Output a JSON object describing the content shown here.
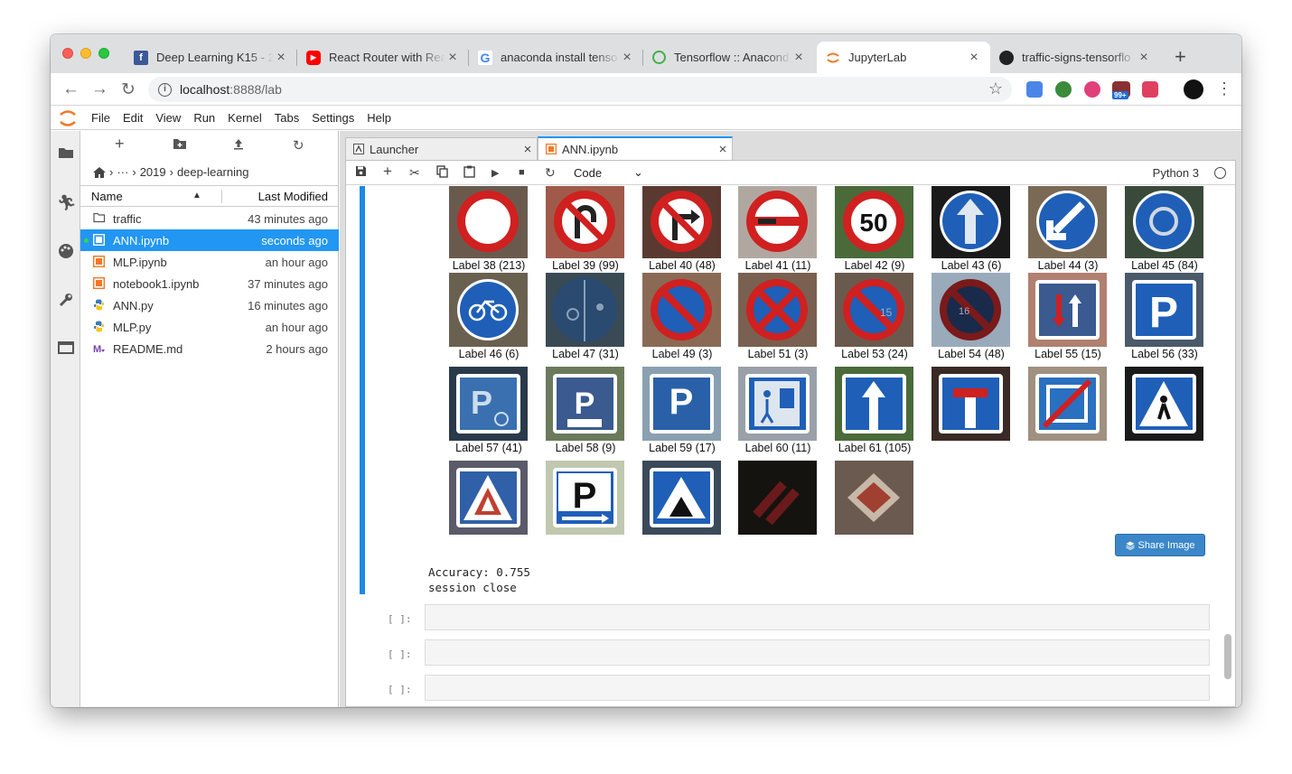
{
  "browser": {
    "tabs": [
      {
        "title": "Deep Learning K15 - 2",
        "icon": "facebook-icon",
        "color": "#3b5998",
        "active": false
      },
      {
        "title": "React Router with Rea",
        "icon": "youtube-icon",
        "color": "#ff0000",
        "active": false
      },
      {
        "title": "anaconda install tenso",
        "icon": "google-icon",
        "color": "#4285f4",
        "active": false
      },
      {
        "title": "Tensorflow :: Anacond",
        "icon": "anaconda-icon",
        "color": "#43b049",
        "active": false
      },
      {
        "title": "JupyterLab",
        "icon": "jupyter-icon",
        "color": "#f37726",
        "active": true
      },
      {
        "title": "traffic-signs-tensorflo",
        "icon": "github-icon",
        "color": "#222222",
        "active": false
      }
    ],
    "url_host": "localhost",
    "url_rest": ":8888/lab",
    "extension_badge": "99+"
  },
  "jupyter": {
    "menu": [
      "File",
      "Edit",
      "View",
      "Run",
      "Kernel",
      "Tabs",
      "Settings",
      "Help"
    ],
    "breadcrumb": [
      "···",
      "2019",
      "deep-learning"
    ],
    "filebrowser": {
      "col_name": "Name",
      "col_modified": "Last Modified",
      "files": [
        {
          "name": "traffic",
          "modified": "43 minutes ago",
          "type": "folder",
          "selected": false,
          "running": false
        },
        {
          "name": "ANN.ipynb",
          "modified": "seconds ago",
          "type": "notebook",
          "selected": true,
          "running": true
        },
        {
          "name": "MLP.ipynb",
          "modified": "an hour ago",
          "type": "notebook",
          "selected": false,
          "running": false
        },
        {
          "name": "notebook1.ipynb",
          "modified": "37 minutes ago",
          "type": "notebook",
          "selected": false,
          "running": false
        },
        {
          "name": "ANN.py",
          "modified": "16 minutes ago",
          "type": "python",
          "selected": false,
          "running": false
        },
        {
          "name": "MLP.py",
          "modified": "an hour ago",
          "type": "python",
          "selected": false,
          "running": false
        },
        {
          "name": "README.md",
          "modified": "2 hours ago",
          "type": "markdown",
          "selected": false,
          "running": false
        }
      ]
    },
    "doc_tabs": [
      {
        "label": "Launcher",
        "active": false
      },
      {
        "label": "ANN.ipynb",
        "active": true
      }
    ],
    "cell_type": "Code",
    "kernel": "Python 3",
    "share_button": "Share Image",
    "output_lines": [
      "Accuracy: 0.755",
      "session close"
    ],
    "empty_prompt": "[ ]:",
    "signs": [
      {
        "label": "Label 38 (213)",
        "bg": "#6a5a4e",
        "shape": "circle-red-white"
      },
      {
        "label": "Label 39 (99)",
        "bg": "#a05a4a",
        "shape": "circle-red-uturn"
      },
      {
        "label": "Label 40 (48)",
        "bg": "#5a3a30",
        "shape": "circle-red-turn"
      },
      {
        "label": "Label 41 (11)",
        "bg": "#b0a8a0",
        "shape": "circle-red-bar"
      },
      {
        "label": "Label 42 (9)",
        "bg": "#4a6a3a",
        "shape": "speed-50"
      },
      {
        "label": "Label 43 (6)",
        "bg": "#1a1a1a",
        "shape": "blue-arrow-up"
      },
      {
        "label": "Label 44 (3)",
        "bg": "#7a6a55",
        "shape": "blue-arrow-diag"
      },
      {
        "label": "Label 45 (84)",
        "bg": "#3a4a3a",
        "shape": "blue-roundabout"
      },
      {
        "label": "Label 46 (6)",
        "bg": "#6a6050",
        "shape": "blue-bike"
      },
      {
        "label": "Label 47 (31)",
        "bg": "#3a4a55",
        "shape": "blue-bike-dark"
      },
      {
        "label": "Label 49 (3)",
        "bg": "#8a6a55",
        "shape": "no-parking"
      },
      {
        "label": "Label 51 (3)",
        "bg": "#7a6050",
        "shape": "no-stopping"
      },
      {
        "label": "Label 53 (24)",
        "bg": "#6a5a4e",
        "shape": "no-parking-15"
      },
      {
        "label": "Label 54 (48)",
        "bg": "#5a6a7a",
        "shape": "no-parking-dark"
      },
      {
        "label": "Label 55 (15)",
        "bg": "#b08070",
        "shape": "blue-arrows"
      },
      {
        "label": "Label 56 (33)",
        "bg": "#4a5a6a",
        "shape": "blue-p"
      },
      {
        "label": "Label 57 (41)",
        "bg": "#2a3a4a",
        "shape": "blue-p-disabled"
      },
      {
        "label": "Label 58 (9)",
        "bg": "#6a7a5a",
        "shape": "blue-p-white"
      },
      {
        "label": "Label 59 (17)",
        "bg": "#8aa0b0",
        "shape": "blue-p-light"
      },
      {
        "label": "Label 60 (11)",
        "bg": "#9aa0a8",
        "shape": "blue-woonerf"
      },
      {
        "label": "Label 61 (105)",
        "bg": "#4a6a3a",
        "shape": "blue-arrow-square"
      },
      {
        "label": "",
        "bg": "#3a2a25",
        "shape": "blue-dead-end"
      },
      {
        "label": "",
        "bg": "#a09080",
        "shape": "blue-red-strike"
      },
      {
        "label": "",
        "bg": "#1a1a1a",
        "shape": "blue-crossing"
      },
      {
        "label": "",
        "bg": "#5a5a6a",
        "shape": "blue-triangle-red"
      },
      {
        "label": "",
        "bg": "#c0c8b0",
        "shape": "blue-p-arrow"
      },
      {
        "label": "",
        "bg": "#3a4a5a",
        "shape": "blue-triangle"
      },
      {
        "label": "",
        "bg": "#1a1a15",
        "shape": "dark-red-stripes"
      },
      {
        "label": "",
        "bg": "#5a4a40",
        "shape": "priority-road"
      }
    ]
  }
}
